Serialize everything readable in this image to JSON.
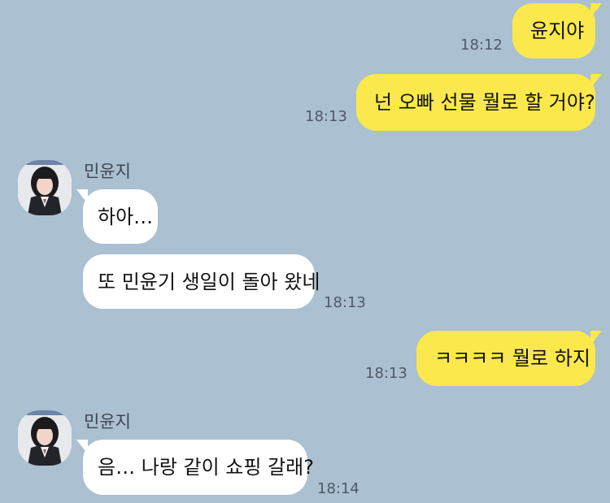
{
  "chat": {
    "participants": {
      "friend_name": "민윤지"
    },
    "messages": [
      {
        "sender": "me",
        "text": "윤지야",
        "time": "18:12"
      },
      {
        "sender": "me",
        "text": "넌 오빠 선물 뭘로 할 거야?",
        "time": "18:13"
      },
      {
        "sender": "friend",
        "name": "민윤지",
        "text": "하아…"
      },
      {
        "sender": "friend",
        "text": "또 민윤기 생일이 돌아 왔네",
        "time": "18:13"
      },
      {
        "sender": "me",
        "text": "ㅋㅋㅋㅋ 뭘로 하지",
        "time": "18:13"
      },
      {
        "sender": "friend",
        "name": "민윤지",
        "text": "음… 나랑 같이 쇼핑 갈래?",
        "time": "18:14"
      }
    ]
  },
  "colors": {
    "background": "#abc0d1",
    "my_bubble": "#fae84c",
    "friend_bubble": "#ffffff"
  }
}
